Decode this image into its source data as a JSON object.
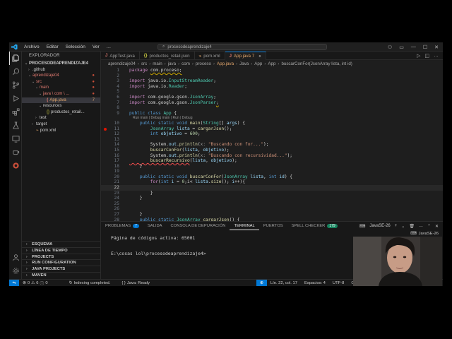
{
  "menu": {
    "items": [
      "Archivo",
      "Editar",
      "Selección",
      "Ver",
      "…"
    ],
    "search": "procesodeaprendizaje4"
  },
  "explorer": {
    "header": "EXPLORADOR",
    "root": "PROCESODEAPRENDIZAJE4",
    "tree": [
      {
        "label": ".github",
        "depth": 1,
        "arrow": "›",
        "color": "#cccccc"
      },
      {
        "label": "aprendizaje04",
        "depth": 1,
        "arrow": "⌄",
        "color": "#e07a70",
        "mark": "●"
      },
      {
        "label": "src",
        "depth": 2,
        "arrow": "⌄",
        "color": "#e07a70",
        "mark": "●"
      },
      {
        "label": "main",
        "depth": 3,
        "arrow": "⌄",
        "color": "#e07a70",
        "mark": "●"
      },
      {
        "label": "java \\ com \\ ...",
        "depth": 4,
        "arrow": "⌄",
        "color": "#e07a70",
        "mark": "●"
      },
      {
        "label": "App.java",
        "depth": 5,
        "arrow": "",
        "color": "#e2a66c",
        "mark": "7",
        "selected": true
      },
      {
        "label": "resources",
        "depth": 4,
        "arrow": "⌄",
        "color": "#cccccc"
      },
      {
        "label": "productos_retail...",
        "depth": 5,
        "arrow": "",
        "color": "#cccccc",
        "prefix": "{}"
      },
      {
        "label": "test",
        "depth": 3,
        "arrow": "›",
        "color": "#cccccc"
      },
      {
        "label": "target",
        "depth": 2,
        "arrow": "›",
        "color": "#cccccc"
      },
      {
        "label": "pom.xml",
        "depth": 2,
        "arrow": "",
        "color": "#cccccc",
        "prefix": "⌁"
      }
    ],
    "sections": [
      "ESQUEMA",
      "LÍNEA DE TIEMPO",
      "PROJECTS",
      "RUN CONFIGURATION",
      "JAVA PROJECTS",
      "MAVEN"
    ]
  },
  "tabs": [
    {
      "label": "AppTest.java",
      "icon": "J",
      "active": false
    },
    {
      "label": "productos_retail.json",
      "icon": "{}",
      "active": false
    },
    {
      "label": "pom.xml",
      "icon": "⌁",
      "active": false
    },
    {
      "label": "App.java 7",
      "icon": "J",
      "active": true
    }
  ],
  "breadcrumb": [
    "aprendizaje04",
    "src",
    "main",
    "java",
    "com",
    "proceso",
    "App.java",
    "Java",
    "App",
    "App",
    "buscarConFor(JsonArray lista, int id)"
  ],
  "code": {
    "lens1": "Run main | Debug main | Run | Debug",
    "lines": [
      {
        "n": "1",
        "parts": [
          [
            "kw2",
            "package "
          ],
          [
            "",
            "com.proceso;"
          ]
        ],
        "squig": true
      },
      {
        "n": "2",
        "parts": []
      },
      {
        "n": "3",
        "parts": [
          [
            "kw2",
            "import "
          ],
          [
            "",
            "java.io."
          ],
          [
            "ty",
            "InputStreamReader"
          ],
          [
            "",
            ";"
          ]
        ]
      },
      {
        "n": "4",
        "parts": [
          [
            "kw2",
            "import "
          ],
          [
            "",
            "java.io."
          ],
          [
            "ty",
            "Reader"
          ],
          [
            "",
            ";"
          ]
        ]
      },
      {
        "n": "5",
        "parts": []
      },
      {
        "n": "6",
        "parts": [
          [
            "kw2",
            "import "
          ],
          [
            "",
            "com.google.gson."
          ],
          [
            "ty",
            "JsonArray"
          ],
          [
            "",
            ";"
          ]
        ]
      },
      {
        "n": "7",
        "parts": [
          [
            "kw2",
            "import "
          ],
          [
            "",
            "com.google.gson."
          ],
          [
            "ty",
            "JsonParser"
          ],
          [
            "",
            ";"
          ]
        ],
        "squig": true
      },
      {
        "n": "8",
        "parts": []
      },
      {
        "n": "9",
        "parts": [
          [
            "kw",
            "public class "
          ],
          [
            "ty",
            "App "
          ],
          [
            "",
            "{"
          ]
        ]
      },
      {
        "n": "10",
        "parts": [
          [
            "kw",
            "    public static void "
          ],
          [
            "fn",
            "main"
          ],
          [
            "",
            "("
          ],
          [
            "ty",
            "String"
          ],
          [
            "",
            "[] "
          ],
          [
            "var",
            "args"
          ],
          [
            "",
            ") {"
          ]
        ],
        "lensBefore": true
      },
      {
        "n": "11",
        "parts": [
          [
            "ty",
            "        JsonArray "
          ],
          [
            "var",
            "lista"
          ],
          [
            "",
            " = "
          ],
          [
            "fn",
            "cargarJson"
          ],
          [
            "",
            "();"
          ]
        ],
        "bp": true
      },
      {
        "n": "12",
        "parts": [
          [
            "kw",
            "        int "
          ],
          [
            "var",
            "objetivo"
          ],
          [
            "",
            " = "
          ],
          [
            "num",
            "600"
          ],
          [
            "",
            ";"
          ]
        ]
      },
      {
        "n": "13",
        "parts": []
      },
      {
        "n": "14",
        "parts": [
          [
            "",
            "        System."
          ],
          [
            "var",
            "out"
          ],
          [
            "",
            "."
          ],
          [
            "fn",
            "println"
          ],
          [
            "",
            "("
          ],
          [
            "hint",
            "x: "
          ],
          [
            "str",
            "\"Buscando con for...\""
          ],
          [
            "",
            ");"
          ]
        ]
      },
      {
        "n": "15",
        "parts": [
          [
            "fn",
            "        buscarConFor"
          ],
          [
            "",
            "("
          ],
          [
            "var",
            "lista"
          ],
          [
            "",
            ", "
          ],
          [
            "var",
            "objetivo"
          ],
          [
            "",
            ");"
          ]
        ]
      },
      {
        "n": "16",
        "parts": [
          [
            "",
            "        System."
          ],
          [
            "var",
            "out"
          ],
          [
            "",
            "."
          ],
          [
            "fn",
            "println"
          ],
          [
            "",
            "("
          ],
          [
            "hint",
            "x: "
          ],
          [
            "str",
            "\"Buscando con recursividad...\""
          ],
          [
            "",
            ");"
          ]
        ]
      },
      {
        "n": "17",
        "parts": [
          [
            "fn",
            "        buscarRecursivo"
          ],
          [
            "",
            "("
          ],
          [
            "var",
            "lista"
          ],
          [
            "",
            ", "
          ],
          [
            "var",
            "objetivo"
          ],
          [
            "",
            ");"
          ]
        ]
      },
      {
        "n": "18",
        "parts": [
          [
            "",
            "    }"
          ]
        ]
      },
      {
        "n": "19",
        "parts": []
      },
      {
        "n": "20",
        "parts": [
          [
            "kw",
            "    public static void "
          ],
          [
            "fn",
            "buscarConFor"
          ],
          [
            "",
            "("
          ],
          [
            "ty",
            "JsonArray "
          ],
          [
            "var",
            "lista"
          ],
          [
            "",
            ", "
          ],
          [
            "kw",
            "int "
          ],
          [
            "var",
            "id"
          ],
          [
            "",
            ") {"
          ]
        ]
      },
      {
        "n": "21",
        "parts": [
          [
            "kw2",
            "        for"
          ],
          [
            "",
            "("
          ],
          [
            "kw",
            "int "
          ],
          [
            "var",
            "i"
          ],
          [
            "",
            " = "
          ],
          [
            "num",
            "0"
          ],
          [
            "",
            ";i< "
          ],
          [
            "var",
            "lista"
          ],
          [
            "",
            "."
          ],
          [
            "fn",
            "size"
          ],
          [
            "",
            "(); "
          ],
          [
            "var",
            "i"
          ],
          [
            "",
            "++){"
          ]
        ]
      },
      {
        "n": "22",
        "parts": [],
        "current": true
      },
      {
        "n": "23",
        "parts": [
          [
            "",
            "        }"
          ]
        ]
      },
      {
        "n": "24",
        "parts": [
          [
            "",
            "    }"
          ]
        ]
      },
      {
        "n": "25",
        "parts": []
      },
      {
        "n": "26",
        "parts": []
      },
      {
        "n": "27",
        "parts": [
          [
            "",
            "    }"
          ]
        ]
      },
      {
        "n": "28",
        "parts": [
          [
            "kw",
            "    public static "
          ],
          [
            "ty",
            "JsonArray "
          ],
          [
            "fn",
            "cargarJson"
          ],
          [
            "",
            "() {"
          ]
        ]
      }
    ]
  },
  "panel": {
    "tabs": [
      {
        "label": "PROBLEMAS",
        "badge": "7"
      },
      {
        "label": "SALIDA",
        "badge": ""
      },
      {
        "label": "CONSOLA DE DEPURACIÓN",
        "badge": ""
      },
      {
        "label": "TERMINAL",
        "badge": "",
        "active": true
      },
      {
        "label": "PUERTOS",
        "badge": ""
      },
      {
        "label": "SPELL CHECKER",
        "badge": "179"
      }
    ],
    "terminal_name": "JavaSE-26",
    "terminal_tab": "JavaSE-26",
    "terminal_lines": [
      "Página de códigos activa: 65001",
      "",
      "E:\\cosas lol\\procesodeaprendizaje4>"
    ]
  },
  "status": {
    "errors": "0",
    "warnings": "6",
    "info": "0",
    "indexing": "Indexing completed.",
    "java": "Java: Ready",
    "position": "Lín. 22, col. 17",
    "spaces": "Espacios: 4",
    "encoding": "UTF-8",
    "eol": "CR"
  }
}
